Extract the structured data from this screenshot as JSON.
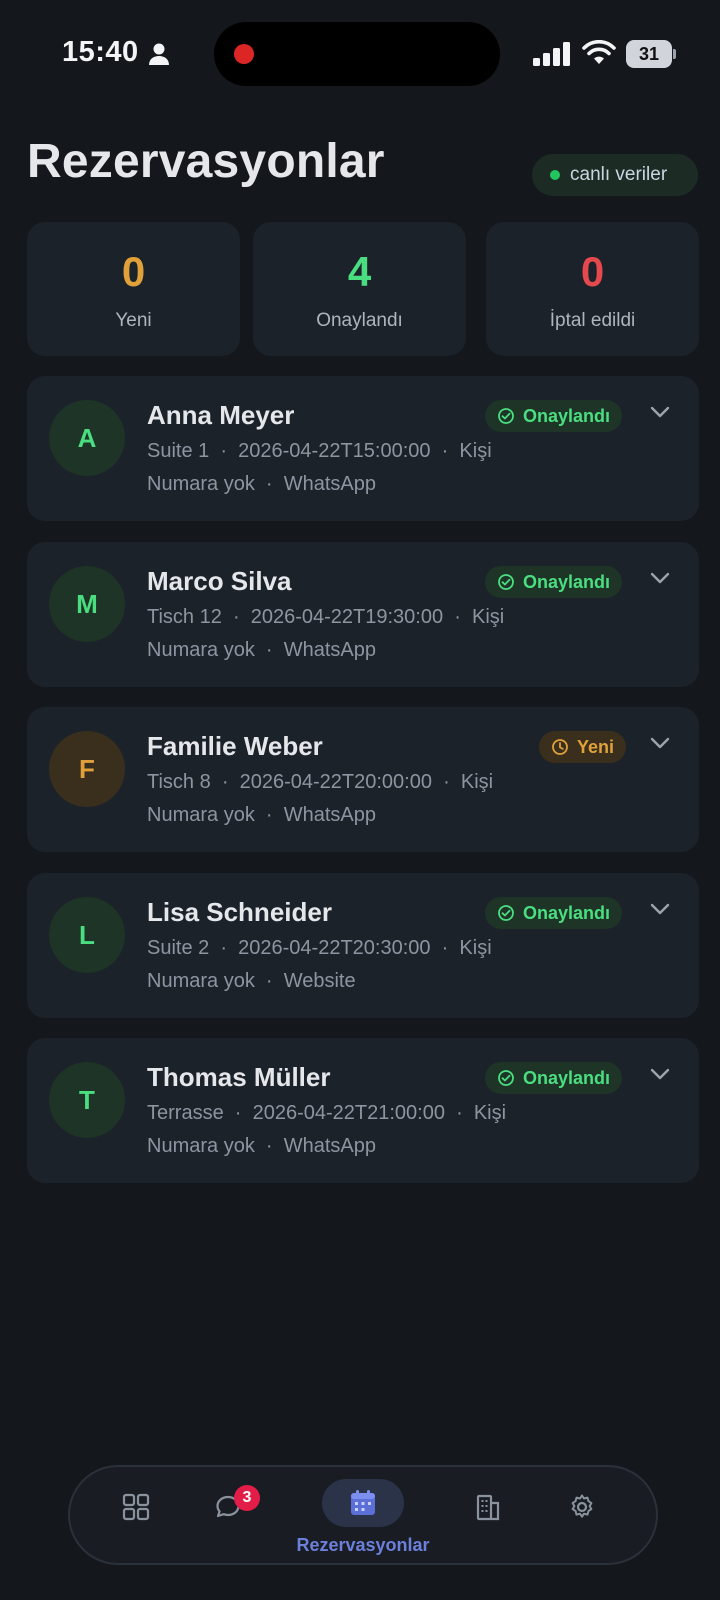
{
  "status_bar": {
    "time": "15:40",
    "battery": "31"
  },
  "header": {
    "title": "Rezervasyonlar",
    "live_label": "canlı veriler"
  },
  "stats": [
    {
      "value": "0",
      "label": "Yeni",
      "color": "#e0a13a"
    },
    {
      "value": "4",
      "label": "Onaylandı",
      "color": "#4ade80"
    },
    {
      "value": "0",
      "label": "İptal edildi",
      "color": "#e5484d"
    }
  ],
  "reservations": [
    {
      "initial": "A",
      "name": "Anna Meyer",
      "status": "Onaylandı",
      "status_type": "confirmed",
      "meta1": "Suite 1  ·  2026-04-22T15:00:00  ·  Kişi",
      "meta2": "Numara yok  ·  WhatsApp"
    },
    {
      "initial": "M",
      "name": "Marco Silva",
      "status": "Onaylandı",
      "status_type": "confirmed",
      "meta1": "Tisch 12  ·  2026-04-22T19:30:00  ·  Kişi",
      "meta2": "Numara yok  ·  WhatsApp"
    },
    {
      "initial": "F",
      "name": "Familie Weber",
      "status": "Yeni",
      "status_type": "new",
      "meta1": "Tisch 8  ·  2026-04-22T20:00:00  ·  Kişi",
      "meta2": "Numara yok  ·  WhatsApp"
    },
    {
      "initial": "L",
      "name": "Lisa Schneider",
      "status": "Onaylandı",
      "status_type": "confirmed",
      "meta1": "Suite 2  ·  2026-04-22T20:30:00  ·  Kişi",
      "meta2": "Numara yok  ·  Website"
    },
    {
      "initial": "T",
      "name": "Thomas Müller",
      "status": "Onaylandı",
      "status_type": "confirmed",
      "meta1": "Terrasse  ·  2026-04-22T21:00:00  ·  Kişi",
      "meta2": "Numara yok  ·  WhatsApp"
    }
  ],
  "bottom_nav": {
    "items": [
      "grid-icon",
      "chat-icon",
      "calendar-icon",
      "building-icon",
      "gear-icon"
    ],
    "chat_badge": "3",
    "active_label": "Rezervasyonlar"
  },
  "colors": {
    "background": "#14171c",
    "card": "#1c222a",
    "confirmed": "#4ade80",
    "new": "#e0a13a",
    "cancelled": "#e5484d",
    "accent": "#6b7fdb"
  }
}
